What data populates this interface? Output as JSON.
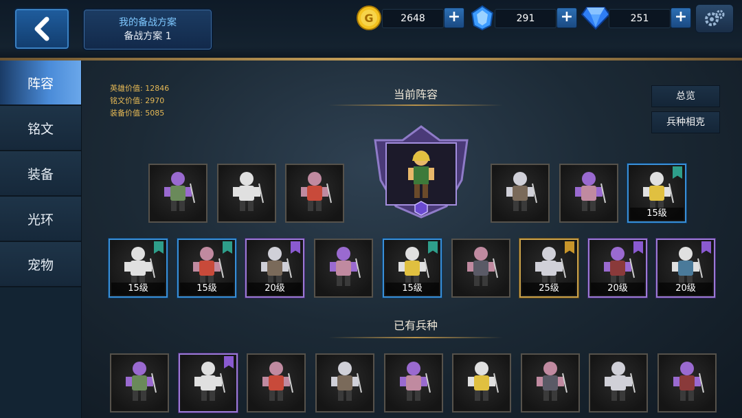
{
  "header": {
    "back_icon": "chevron-left-icon",
    "plan_title": "我的备战方案",
    "plan_name": "备战方案 1",
    "gold": "2648",
    "crystal": "291",
    "diamond": "251",
    "settings_icon": "gear-icon",
    "colors": {
      "gold": "#f4c21f",
      "crystal": "#4aa6ff",
      "diamond": "#3f8dff"
    }
  },
  "sidebar": {
    "items": [
      {
        "label": "阵容",
        "active": true
      },
      {
        "label": "铭文",
        "active": false
      },
      {
        "label": "装备",
        "active": false
      },
      {
        "label": "光环",
        "active": false
      },
      {
        "label": "宠物",
        "active": false
      }
    ]
  },
  "stats": {
    "hero_value": "英雄价值: 12846",
    "rune_value": "铭文价值: 2970",
    "equip_value": "装备价值: 5085"
  },
  "current_lineup": {
    "title": "当前阵容",
    "overview_btn": "总览",
    "counter_btn": "兵种相克",
    "leader": {
      "icon": "hero-leader-icon",
      "rank_icon": "rank-gem-icon"
    },
    "row1": [
      {
        "icon": "red-knight-icon",
        "level": "",
        "frame": "plain"
      },
      {
        "icon": "samurai-icon",
        "level": "",
        "frame": "plain"
      },
      {
        "icon": "mummy-icon",
        "level": "",
        "frame": "plain"
      },
      {
        "icon": "blonde-warrior-icon",
        "level": "",
        "frame": "plain"
      },
      {
        "icon": "ninja-icon",
        "level": "",
        "frame": "plain"
      },
      {
        "icon": "skeleton-knight-icon",
        "level": "15级",
        "frame": "blue"
      }
    ],
    "row2": [
      {
        "icon": "fighter-icon",
        "level": "15级",
        "frame": "blue"
      },
      {
        "icon": "spear-guard-icon",
        "level": "15级",
        "frame": "blue"
      },
      {
        "icon": "vampire-icon",
        "level": "20级",
        "frame": "purple"
      },
      {
        "icon": "beast-icon",
        "level": "",
        "frame": "plain"
      },
      {
        "icon": "cavalry-icon",
        "level": "15级",
        "frame": "blue"
      },
      {
        "icon": "winged-warrior-icon",
        "level": "",
        "frame": "plain"
      },
      {
        "icon": "hooded-mage-icon",
        "level": "25级",
        "frame": "gold"
      },
      {
        "icon": "paladin-icon",
        "level": "20级",
        "frame": "purple"
      },
      {
        "icon": "lord-icon",
        "level": "20级",
        "frame": "purple"
      }
    ]
  },
  "owned_units": {
    "title": "已有兵种",
    "items": [
      {
        "icon": "crystal-totem-icon",
        "frame": "plain"
      },
      {
        "icon": "swordsman-hero-icon",
        "frame": "purple"
      },
      {
        "icon": "armored-soldier-icon",
        "frame": "plain"
      },
      {
        "icon": "nun-icon",
        "frame": "plain"
      },
      {
        "icon": "dark-knight-icon",
        "frame": "plain"
      },
      {
        "icon": "heavy-knight-icon",
        "frame": "plain"
      },
      {
        "icon": "witch-icon",
        "frame": "plain"
      },
      {
        "icon": "greatsword-knight-icon",
        "frame": "plain"
      },
      {
        "icon": "hammer-dwarf-icon",
        "frame": "plain"
      }
    ]
  }
}
